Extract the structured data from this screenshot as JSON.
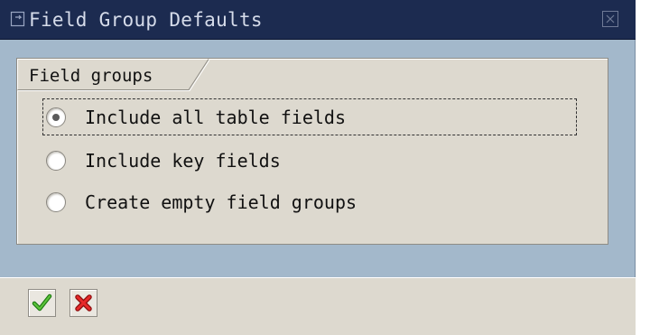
{
  "window": {
    "title": "Field Group Defaults"
  },
  "groupbox": {
    "title": "Field groups"
  },
  "options": [
    {
      "label": "Include all table fields",
      "selected": true
    },
    {
      "label": "Include key fields",
      "selected": false
    },
    {
      "label": "Create empty field groups",
      "selected": false
    }
  ],
  "toolbar": {
    "confirm_icon": "checkmark-icon",
    "cancel_icon": "cross-icon"
  },
  "colors": {
    "titlebar": "#1c2b50",
    "window_bg": "#a3b8cb",
    "panel_bg": "#ddd9cf",
    "confirm_green": "#2e9a1a",
    "cancel_red": "#d0191a"
  }
}
